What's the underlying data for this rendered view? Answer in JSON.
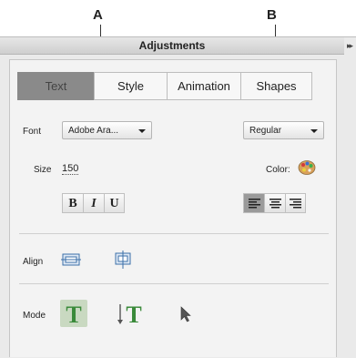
{
  "callouts": {
    "a": "A",
    "b": "B"
  },
  "panel": {
    "title": "Adjustments"
  },
  "tabs": [
    {
      "label": "Text",
      "active": true
    },
    {
      "label": "Style",
      "active": false
    },
    {
      "label": "Animation",
      "active": false
    },
    {
      "label": "Shapes",
      "active": false
    }
  ],
  "font": {
    "label": "Font",
    "value": "Adobe Ara..."
  },
  "style": {
    "value": "Regular"
  },
  "size": {
    "label": "Size",
    "value": "150"
  },
  "color": {
    "label": "Color:"
  },
  "format": {
    "bold": "B",
    "italic": "I",
    "underline": "U"
  },
  "align": {
    "label": "Align"
  },
  "mode": {
    "label": "Mode"
  },
  "colors": {
    "panel_bg": "#eaeaea",
    "active_tab": "#8a8a8a",
    "mode_green": "#3a8a3a"
  }
}
